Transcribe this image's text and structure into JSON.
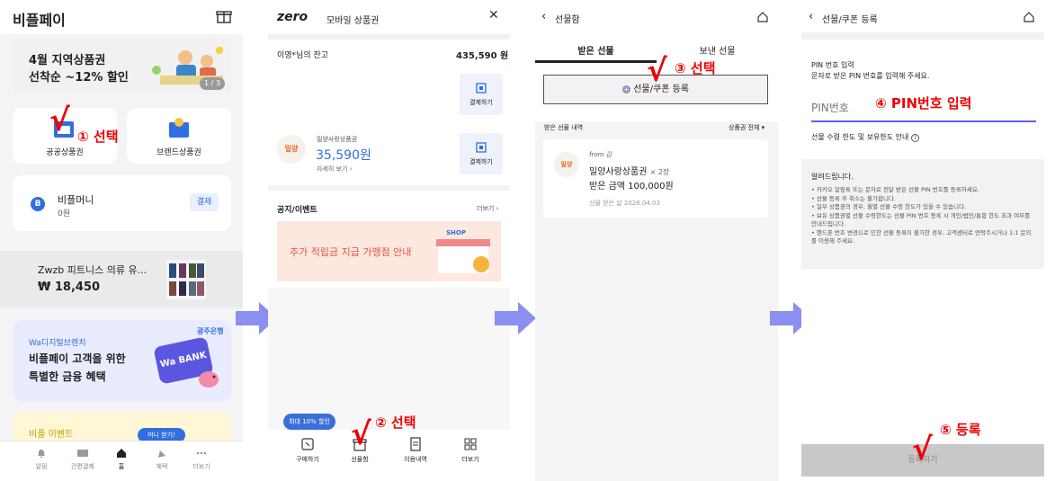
{
  "s1": {
    "title": "비플페이",
    "banner": {
      "line1": "4월 지역상품권",
      "line2": "선착순 ~12% 할인",
      "page": "1 / 3"
    },
    "tile_public": "공공상품권",
    "tile_brand": "브랜드상품권",
    "money_label": "비플머니",
    "money_value": "0원",
    "pay_btn": "결제",
    "product_name": "Zwzb 피트니스 의류 유...",
    "product_price": "₩ 18,450",
    "promo": {
      "bank": "광주은행",
      "sub": "Wa디지털브랜치",
      "line1": "비플페이 고객을 위한",
      "line2": "특별한 금융 혜택",
      "card_text": "Wa BANK"
    },
    "event": "비플 이벤트",
    "money_tip": "머니 받기!",
    "nav": [
      "알림",
      "간편결제",
      "홈",
      "혜택",
      "더보기"
    ],
    "step": "① 선택"
  },
  "s2": {
    "logo": "zero",
    "title": "모바일 상품권",
    "balance_label": "이영*님의 잔고",
    "balance_value": "435,590 원",
    "pay_label": "결제하기",
    "voucher_logo": "밀양",
    "voucher_name": "밀양사랑상품권",
    "voucher_value": "35,590원",
    "detail_link": "자세히 보기",
    "notice_title": "공지/이벤트",
    "more": "더보기",
    "banner_text": "추가 적립금 지급 가맹점 안내",
    "shop_label": "SHOP",
    "badge": "최대 10% 할인",
    "nav": [
      "구매하기",
      "선물함",
      "이용내역",
      "더보기"
    ],
    "step": "② 선택"
  },
  "s3": {
    "title": "선물함",
    "tab_received": "받은 선물",
    "tab_sent": "보낸 선물",
    "register_btn": "선물/쿠폰 등록",
    "list_label": "받은 선물 내역",
    "filter": "상품권 전체",
    "from": "from 김",
    "gift_name": "밀양사랑상품권",
    "gift_qty": "× 2장",
    "gift_amount": "받은 금액 100,000원",
    "gift_date": "선물 받은 날 2026.04.03",
    "step": "③ 선택"
  },
  "s4": {
    "title": "선물/쿠폰 등록",
    "pin_title": "PIN 번호 입력",
    "pin_desc": "문자로 받은 PIN 번호를 입력해 주세요.",
    "pin_placeholder": "PIN번호",
    "limit_info": "선물 수령 한도 및 보유한도 안내",
    "notice_title": "알려드립니다.",
    "notices": [
      "카카오 알림톡 또는 문자로 전달 받은 선물 PIN 번호를 등록하세요.",
      "선물 등록 후 취소는 불가합니다.",
      "일부 상품권의 경우, 월별 선물 수령 한도가 있을 수 있습니다.",
      "보유 상품권별 선물 수령한도는 선물 PIN 번호 등록 시 개인/법인/통합 한도 초과 여부를 안내드립니다.",
      "핸드폰 번호 변경으로 인한 선물 등록이 불가한 경우, 고객센터로 연락주시거나 1:1 문의를 이용해 주세요."
    ],
    "register_btn": "등록하기",
    "step_input": "④ PIN번호 입력",
    "step_register": "⑤ 등록"
  },
  "colors": {
    "accent": "#2f6fe0",
    "arrow": "#8a8ff0",
    "red": "#e00000"
  }
}
